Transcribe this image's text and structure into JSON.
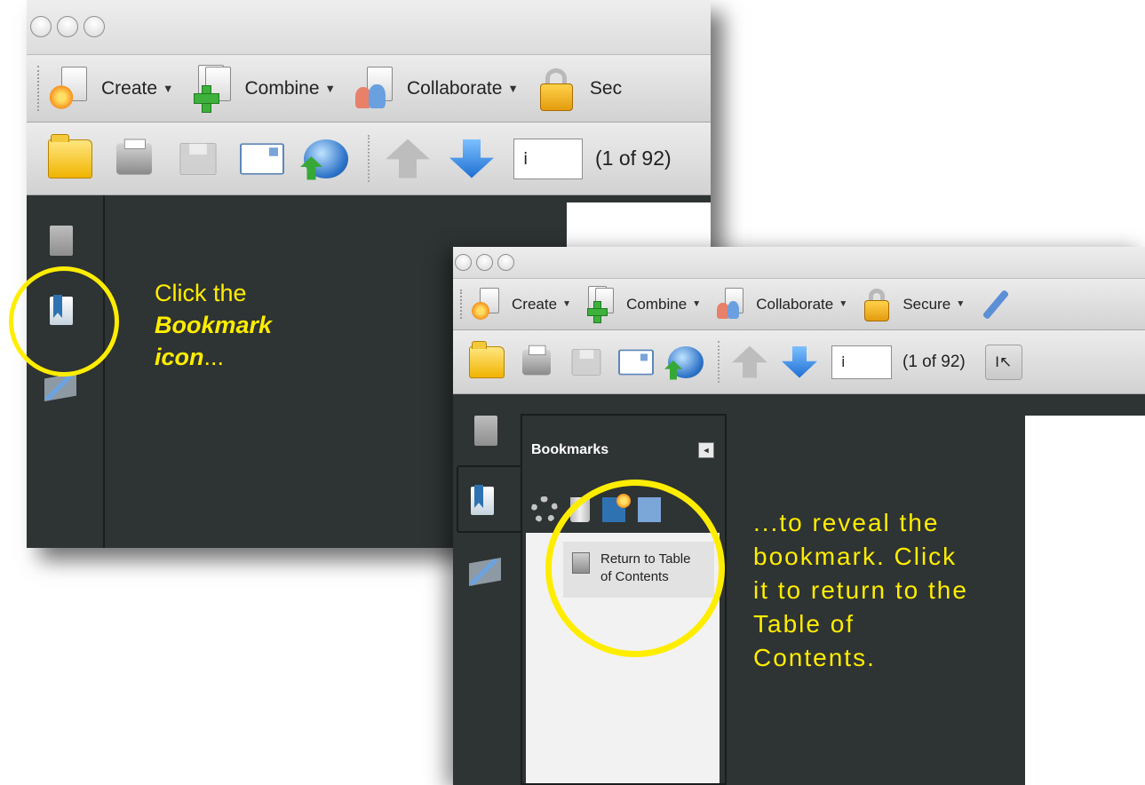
{
  "window_back": {
    "toolbar1": {
      "create": "Create",
      "combine": "Combine",
      "collaborate": "Collaborate",
      "secure": "Sec"
    },
    "toolbar2": {
      "page_field": "i",
      "page_count": "(1 of 92)"
    }
  },
  "window_front": {
    "toolbar1": {
      "create": "Create",
      "combine": "Combine",
      "collaborate": "Collaborate",
      "secure": "Secure"
    },
    "toolbar2": {
      "page_field": "i",
      "page_count": "(1 of 92)",
      "select_tool": "I"
    },
    "bookmarks_panel": {
      "title": "Bookmarks",
      "collapse_symbol": "◂",
      "items": [
        {
          "label": "Return to Table of Contents"
        }
      ]
    }
  },
  "callouts": {
    "first_line": "Click the",
    "first_emphasis_a": "Bookmark",
    "first_emphasis_b": "icon",
    "first_tail": "...",
    "second": "...to reveal the bookmark. Click it to return to the Table of Contents."
  },
  "colors": {
    "highlight": "#ffed00",
    "panel_bg": "#2e3333",
    "accent_blue": "#2e72b2"
  },
  "icons": [
    "create-icon",
    "combine-icon",
    "collaborate-icon",
    "secure-icon",
    "open-folder-icon",
    "print-icon",
    "save-icon",
    "email-icon",
    "web-icon",
    "previous-page-icon",
    "next-page-icon",
    "pages-icon",
    "bookmark-icon",
    "signature-icon",
    "gear-icon",
    "trash-icon",
    "new-bookmark-icon"
  ]
}
